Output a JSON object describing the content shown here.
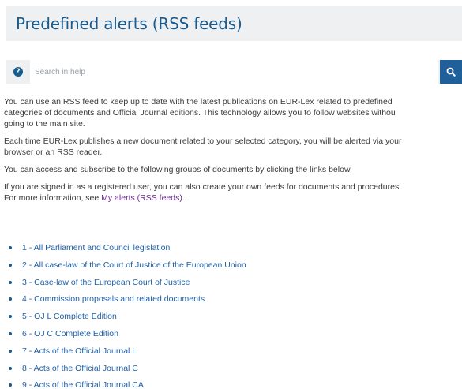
{
  "page": {
    "title": "Predefined alerts (RSS feeds)"
  },
  "search": {
    "help_icon": "question-circle-icon",
    "placeholder": "Search in help",
    "button_icon": "search-icon"
  },
  "content": {
    "paragraph1_lines": [
      "You can use an RSS feed to keep up to date with the latest publications on EUR-Lex related to predefined",
      "categories of documents and Official Journal editions. This technology allows you to follow websites withou",
      "going to the main site."
    ],
    "paragraph2_lines": [
      "Each time EUR-Lex publishes a new document related to your selected category, you will be alerted via your",
      "browser or an RSS reader."
    ],
    "paragraph3": "You can access and subscribe to the following groups of documents by clicking the links below.",
    "paragraph4_line1": "If you are signed in as a registered user, you can also create your own feeds for documents and procedures.",
    "paragraph4_prefix": "For more information, see ",
    "paragraph4_link": "My alerts (RSS feeds)",
    "paragraph4_suffix": "."
  },
  "feeds": [
    "1 - All Parliament and Council legislation",
    "2 - All case-law of the Court of Justice of the European Union",
    "3 - Case-law of the European Court of Justice",
    "4 - Commission proposals and related documents",
    "5 - OJ L Complete Edition",
    "6 - OJ C Complete Edition",
    "7 - Acts of the Official Journal L",
    "8 - Acts of the Official Journal C",
    "9 - Acts of the Official Journal CA"
  ],
  "colors": {
    "title": "#1a5a8c",
    "link": "#1f5fa6",
    "visited_link": "#6a2a8a",
    "search_button": "#1f5f9a",
    "panel_bg": "#eef0f2"
  }
}
